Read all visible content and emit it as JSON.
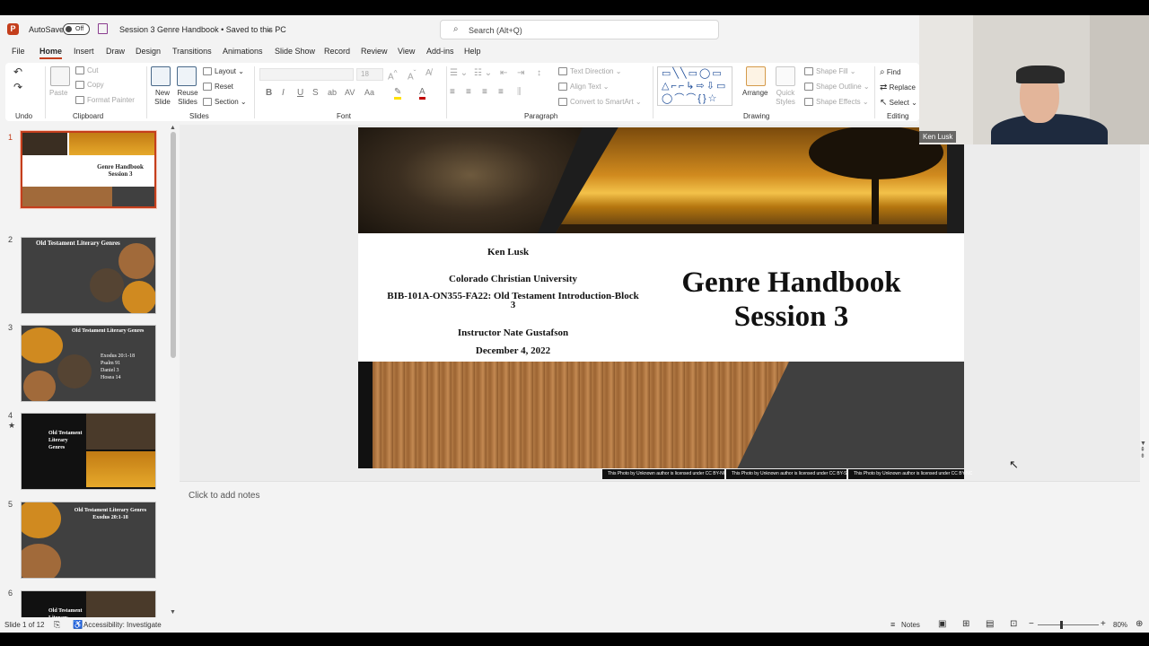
{
  "titlebar": {
    "logo": "P",
    "autosave_label": "AutoSave",
    "autosave_state": "Off",
    "doc_title": "Session 3 Genre Handbook • Saved to this PC",
    "search_placeholder": "Search (Alt+Q)"
  },
  "tabs": [
    "File",
    "Home",
    "Insert",
    "Draw",
    "Design",
    "Transitions",
    "Animations",
    "Slide Show",
    "Record",
    "Review",
    "View",
    "Add-ins",
    "Help"
  ],
  "ribbon": {
    "undo_group": "Undo",
    "clipboard": {
      "paste": "Paste",
      "cut": "Cut",
      "copy": "Copy",
      "format_painter": "Format Painter",
      "label": "Clipboard"
    },
    "slides": {
      "new_slide": "New Slide",
      "reuse_slides": "Reuse Slides",
      "layout": "Layout",
      "reset": "Reset",
      "section": "Section",
      "label": "Slides"
    },
    "font": {
      "size": "18",
      "label": "Font"
    },
    "paragraph": {
      "text_direction": "Text Direction",
      "align_text": "Align Text",
      "convert_smartart": "Convert to SmartArt",
      "label": "Paragraph"
    },
    "drawing": {
      "arrange": "Arrange",
      "quick_styles": "Quick Styles",
      "shape_fill": "Shape Fill",
      "shape_outline": "Shape Outline",
      "shape_effects": "Shape Effects",
      "label": "Drawing"
    },
    "editing": {
      "find": "Find",
      "replace": "Replace",
      "select": "Select",
      "label": "Editing"
    }
  },
  "thumbnails": [
    {
      "num": "1",
      "title": "Genre Handbook Session 3"
    },
    {
      "num": "2",
      "title": "Old Testament Literary Genres"
    },
    {
      "num": "3",
      "title": "Old Testament Literary Genres",
      "items": [
        "Exodus 20:1-18",
        "Psalm 91",
        "Daniel 3",
        "Hosea 14"
      ]
    },
    {
      "num": "4",
      "title": "Old Testament Literary Genres"
    },
    {
      "num": "5",
      "title": "Old Testament Literary Genres Exodus 20:1-18"
    },
    {
      "num": "6",
      "title": "Old Testament Literary Genres"
    }
  ],
  "slide": {
    "presenter": "Ken Lusk",
    "university": "Colorado Christian University",
    "course": "BIB-101A-ON355-FA22: Old Testament Introduction-Block 3",
    "instructor": "Instructor Nate Gustafson",
    "date": "December 4, 2022",
    "title_line1": "Genre Handbook",
    "title_line2": "Session 3",
    "credits": [
      "This Photo by Unknown author is licensed under CC BY-NC-ND",
      "This Photo by Unknown author is licensed under CC BY-SA-NC",
      "This Photo by Unknown author is licensed under CC BY-NC"
    ]
  },
  "notes_placeholder": "Click to add notes",
  "status": {
    "slide_count": "Slide 1 of 12",
    "accessibility": "Accessibility: Investigate",
    "notes": "Notes",
    "zoom": "80%"
  },
  "webcam": {
    "name": "Ken Lusk"
  },
  "colors": {
    "accent": "#c43e1c",
    "slide_dark": "#404040"
  }
}
